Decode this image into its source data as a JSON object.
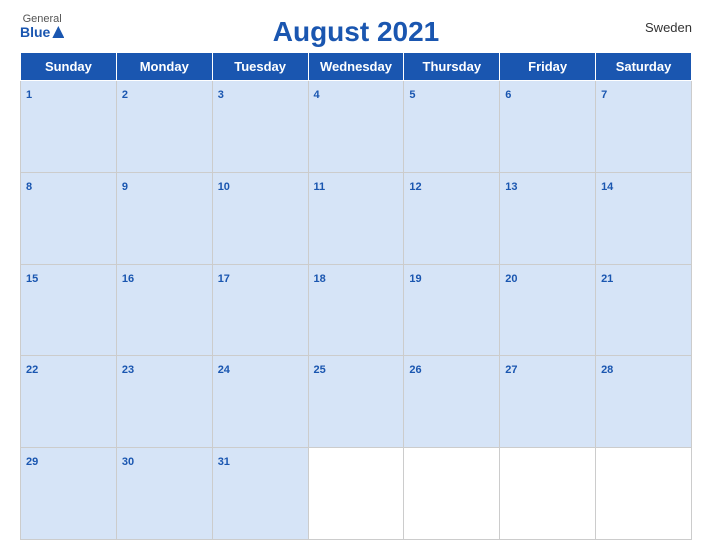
{
  "header": {
    "logo_general": "General",
    "logo_blue": "Blue",
    "month_title": "August 2021",
    "country": "Sweden"
  },
  "weekdays": [
    "Sunday",
    "Monday",
    "Tuesday",
    "Wednesday",
    "Thursday",
    "Friday",
    "Saturday"
  ],
  "weeks": [
    [
      1,
      2,
      3,
      4,
      5,
      6,
      7
    ],
    [
      8,
      9,
      10,
      11,
      12,
      13,
      14
    ],
    [
      15,
      16,
      17,
      18,
      19,
      20,
      21
    ],
    [
      22,
      23,
      24,
      25,
      26,
      27,
      28
    ],
    [
      29,
      30,
      31,
      null,
      null,
      null,
      null
    ]
  ]
}
